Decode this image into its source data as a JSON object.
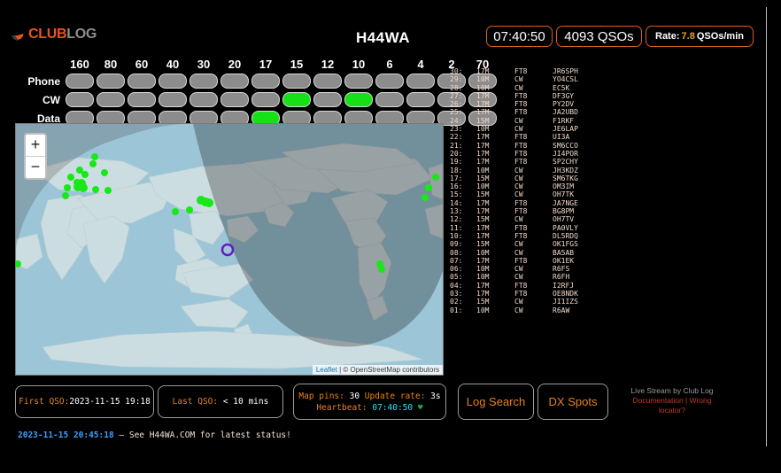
{
  "brand": {
    "club": "CLUB",
    "log": "LOG",
    "logo_icon": "clublog-swoosh-icon"
  },
  "station": {
    "callsign": "H44WA"
  },
  "header": {
    "clock": "07:40:50",
    "qso_count": "4093 QSOs",
    "rate_label": "Rate:",
    "rate_value": "7.8",
    "rate_unit": "QSOs/min"
  },
  "bands": {
    "labels": [
      "160",
      "80",
      "60",
      "40",
      "30",
      "20",
      "17",
      "15",
      "12",
      "10",
      "6",
      "4",
      "2",
      "70"
    ],
    "rows": [
      {
        "name": "Phone",
        "active": [
          false,
          false,
          false,
          false,
          false,
          false,
          false,
          false,
          false,
          false,
          false,
          false,
          false,
          false
        ]
      },
      {
        "name": "CW",
        "active": [
          false,
          false,
          false,
          false,
          false,
          false,
          false,
          true,
          false,
          true,
          false,
          false,
          false,
          false
        ]
      },
      {
        "name": "Data",
        "active": [
          false,
          false,
          false,
          false,
          false,
          false,
          true,
          false,
          false,
          false,
          false,
          false,
          false,
          false
        ]
      }
    ]
  },
  "map": {
    "zoom_in": "+",
    "zoom_out": "−",
    "attribution_leaflet": "Leaflet",
    "attribution_sep": " | ",
    "attribution_osm": "© OpenStreetMap contributors"
  },
  "qso_log": [
    {
      "t": "30:",
      "band": "17M",
      "mode": "FT8",
      "call": "JR6SPH"
    },
    {
      "t": "29:",
      "band": "10M",
      "mode": "CW",
      "call": "YO4CSL"
    },
    {
      "t": "28:",
      "band": "10M",
      "mode": "CW",
      "call": "EC5K"
    },
    {
      "t": "27:",
      "band": "17M",
      "mode": "FT8",
      "call": "DF3GY"
    },
    {
      "t": "26:",
      "band": "17M",
      "mode": "FT8",
      "call": "PY2DV"
    },
    {
      "t": "25:",
      "band": "17M",
      "mode": "FT8",
      "call": "JA2UBD"
    },
    {
      "t": "24:",
      "band": "15M",
      "mode": "CW",
      "call": "F1RKF"
    },
    {
      "t": "23:",
      "band": "10M",
      "mode": "CW",
      "call": "JE6LAP"
    },
    {
      "t": "22:",
      "band": "17M",
      "mode": "FT8",
      "call": "UI3A"
    },
    {
      "t": "21:",
      "band": "17M",
      "mode": "FT8",
      "call": "SM6CCO"
    },
    {
      "t": "20:",
      "band": "17M",
      "mode": "FT8",
      "call": "JI4POR"
    },
    {
      "t": "19:",
      "band": "17M",
      "mode": "FT8",
      "call": "SP2CHY"
    },
    {
      "t": "18:",
      "band": "10M",
      "mode": "CW",
      "call": "JH3KDZ"
    },
    {
      "t": "17:",
      "band": "15M",
      "mode": "CW",
      "call": "SM6TKG"
    },
    {
      "t": "16:",
      "band": "10M",
      "mode": "CW",
      "call": "OM3IM"
    },
    {
      "t": "15:",
      "band": "15M",
      "mode": "CW",
      "call": "OH7TK"
    },
    {
      "t": "14:",
      "band": "17M",
      "mode": "FT8",
      "call": "JA7NGE"
    },
    {
      "t": "13:",
      "band": "17M",
      "mode": "FT8",
      "call": "BG8PM"
    },
    {
      "t": "12:",
      "band": "15M",
      "mode": "CW",
      "call": "OH7TV"
    },
    {
      "t": "11:",
      "band": "17M",
      "mode": "FT8",
      "call": "PA0VLY"
    },
    {
      "t": "10:",
      "band": "17M",
      "mode": "FT8",
      "call": "DL5RDQ"
    },
    {
      "t": "09:",
      "band": "15M",
      "mode": "CW",
      "call": "OK1FGS"
    },
    {
      "t": "08:",
      "band": "10M",
      "mode": "CW",
      "call": "BA5AB"
    },
    {
      "t": "07:",
      "band": "17M",
      "mode": "FT8",
      "call": "OK1EK"
    },
    {
      "t": "06:",
      "band": "10M",
      "mode": "CW",
      "call": "R6FS"
    },
    {
      "t": "05:",
      "band": "10M",
      "mode": "CW",
      "call": "R6FH"
    },
    {
      "t": "04:",
      "band": "17M",
      "mode": "FT8",
      "call": "I2RFJ"
    },
    {
      "t": "03:",
      "band": "17M",
      "mode": "FT8",
      "call": "OE8NDK"
    },
    {
      "t": "02:",
      "band": "15M",
      "mode": "CW",
      "call": "JI1IZS"
    },
    {
      "t": "01:",
      "band": "10M",
      "mode": "CW",
      "call": "R6AW"
    }
  ],
  "status": {
    "first_qso_label": "First QSO:",
    "first_qso_value": "2023-11-15 19:18",
    "last_qso_label": "Last QSO:",
    "last_qso_value": "< 10 mins",
    "map_pins_label": "Map pins:",
    "map_pins_value": "30",
    "update_rate_label": "Update rate:",
    "update_rate_value": "3s",
    "heartbeat_label": "Heartbeat:",
    "heartbeat_value": "07:40:50",
    "heartbeat_icon": "♥"
  },
  "actions": {
    "log_search": "Log Search",
    "dx_spots": "DX Spots"
  },
  "credits": {
    "line1": "Live Stream by Club Log",
    "documentation": "Documentation",
    "sep": " | ",
    "wrong_locator": "Wrong locator?"
  },
  "footer": {
    "timestamp": "2023-11-15 20:45:18",
    "message": "— See H44WA.COM for latest status!"
  },
  "colors": {
    "accent": "#e8831a",
    "border": "#d4601f",
    "pin": "#18e818",
    "home": "#6a1bbf",
    "heartbeat": "#2ee0ff"
  }
}
